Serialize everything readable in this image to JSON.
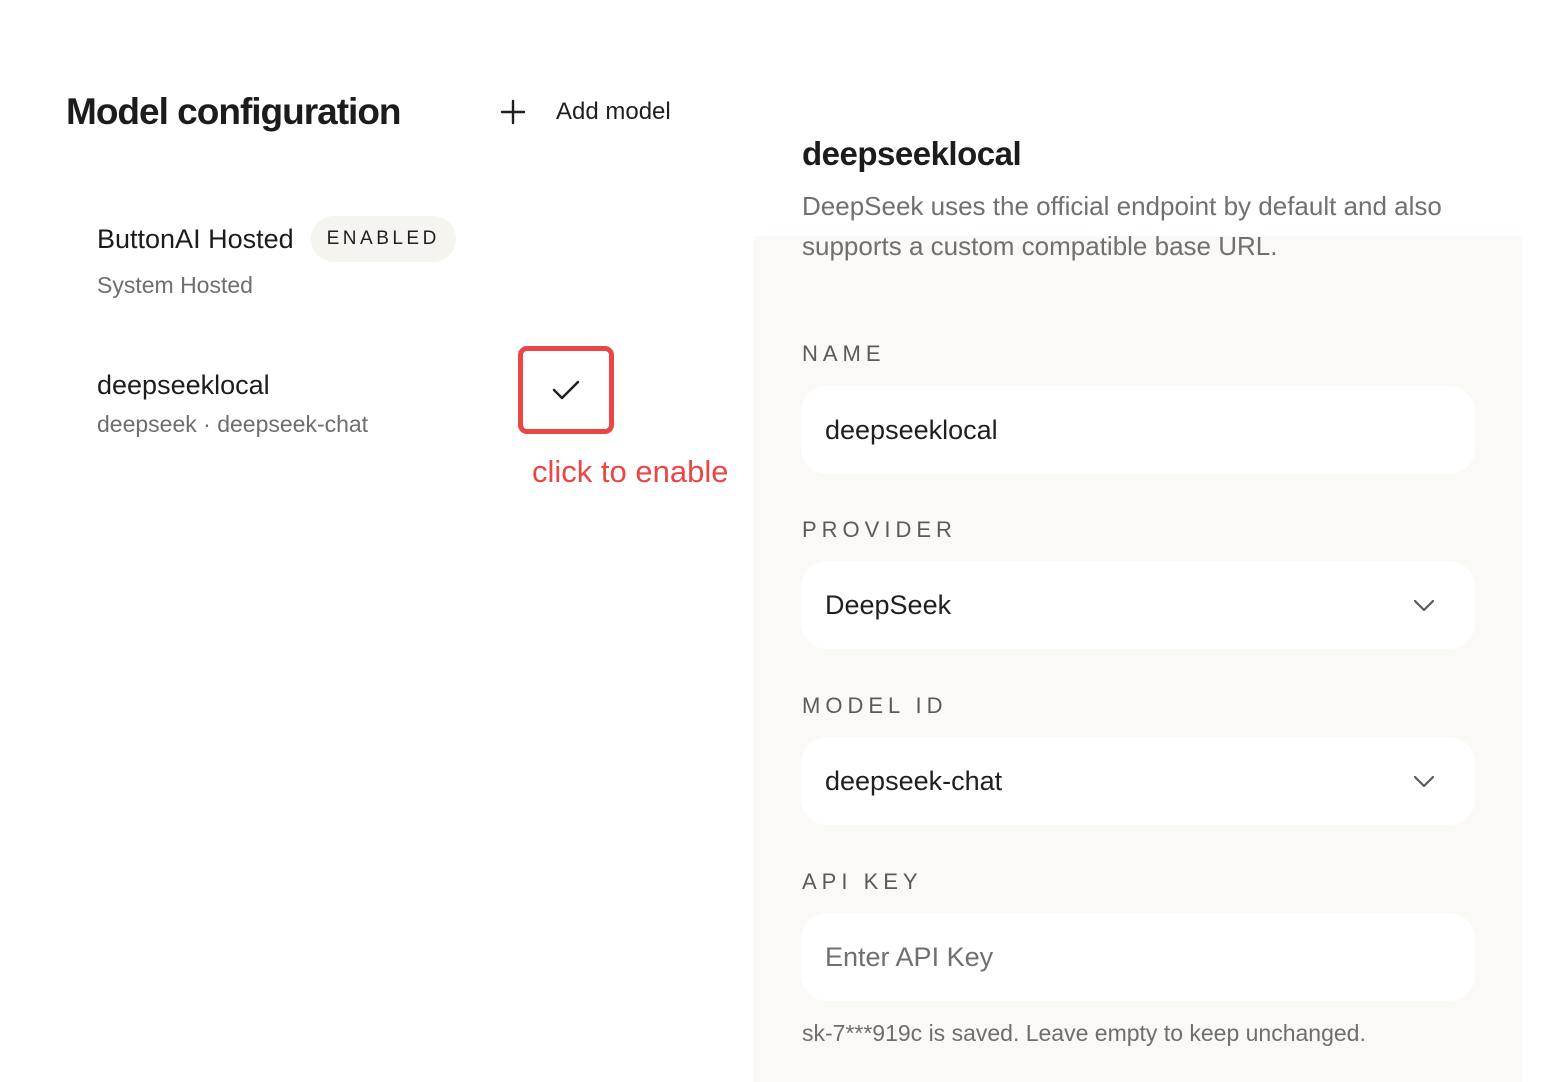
{
  "header": {
    "title": "Model configuration",
    "add_model_label": "Add model",
    "add_model_icon": "plus-icon"
  },
  "models": [
    {
      "name": "ButtonAI Hosted",
      "badge": "ENABLED",
      "subtitle": "System Hosted"
    },
    {
      "name": "deepseeklocal",
      "subtitle": "deepseek · deepseek-chat",
      "toggle_icon": "check-icon"
    }
  ],
  "annotation": {
    "text": "click to enable",
    "color": "#ea4646"
  },
  "detail": {
    "title": "deepseeklocal",
    "description": "DeepSeek uses the official endpoint by default and also supports a custom compatible base URL.",
    "fields": {
      "name": {
        "label": "NAME",
        "value": "deepseeklocal"
      },
      "provider": {
        "label": "PROVIDER",
        "value": "DeepSeek",
        "icon": "chevron-down-icon"
      },
      "model_id": {
        "label": "MODEL ID",
        "value": "deepseek-chat",
        "icon": "chevron-down-icon"
      },
      "api_key": {
        "label": "API KEY",
        "value": "",
        "placeholder": "Enter API Key",
        "helper": "sk-7***919c is saved. Leave empty to keep unchanged."
      }
    }
  },
  "colors": {
    "panel_background": "#faf9f6",
    "badge_background": "#f6f4ef",
    "highlight_red": "#ea4646",
    "muted_text": "#6e6e6e"
  }
}
